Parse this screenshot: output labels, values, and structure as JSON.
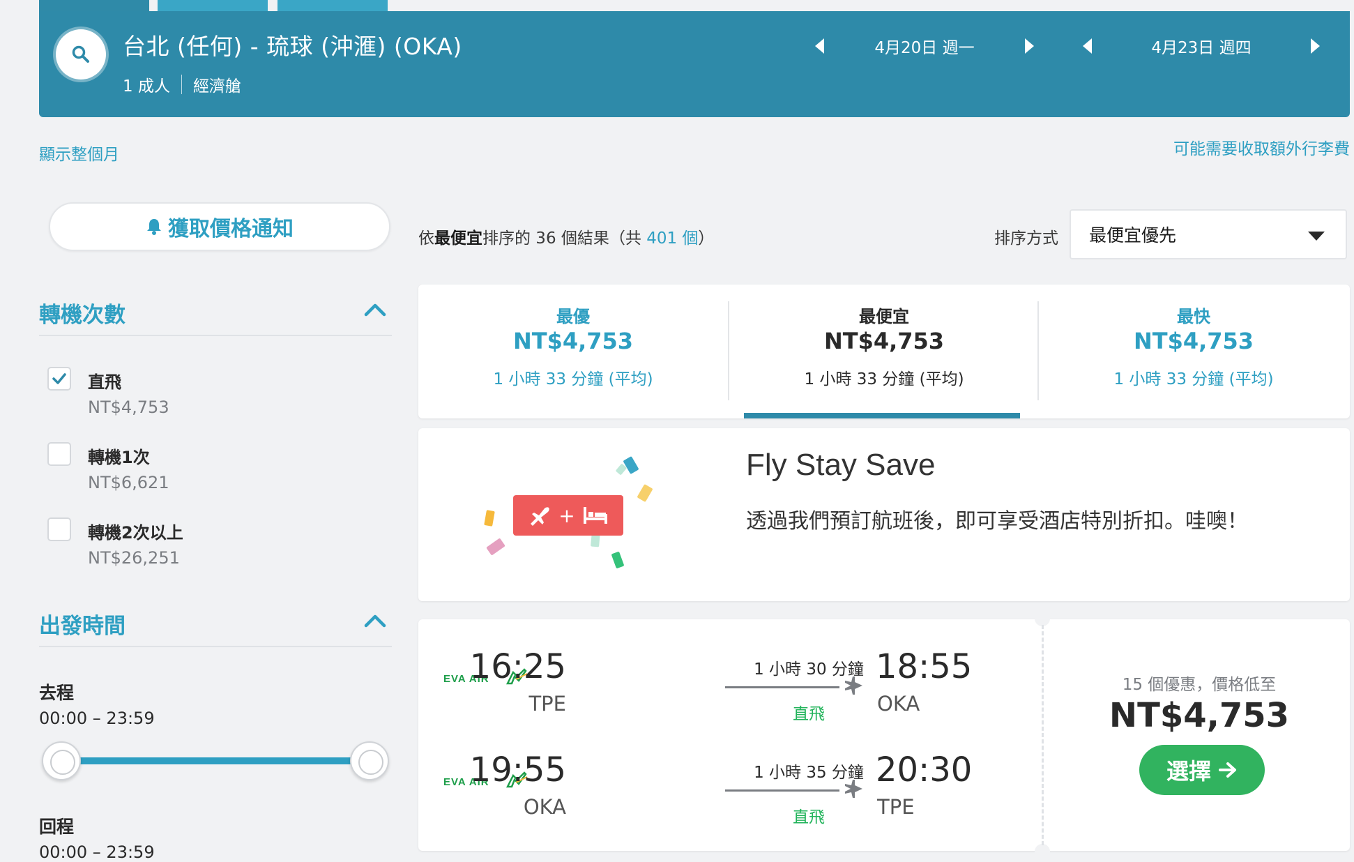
{
  "header": {
    "route": "台北 (任何) - 琉球 (沖滙) (OKA)",
    "passengers": "1 成人",
    "cabin": "經濟艙",
    "depart_date": "4月20日 週一",
    "return_date": "4月23日 週四"
  },
  "links": {
    "show_month": "顯示整個月",
    "baggage": "可能需要收取額外行李費"
  },
  "alert_button": "獲取價格通知",
  "filters": {
    "stops": {
      "title": "轉機次數",
      "options": [
        {
          "label": "直飛",
          "price": "NT$4,753",
          "checked": true
        },
        {
          "label": "轉機1次",
          "price": "NT$6,621",
          "checked": false
        },
        {
          "label": "轉機2次以上",
          "price": "NT$26,251",
          "checked": false
        }
      ]
    },
    "departure_time": {
      "title": "出發時間",
      "outbound_label": "去程",
      "outbound_range": "00:00 – 23:59",
      "return_label": "回程",
      "return_range": "00:00 – 23:59"
    }
  },
  "results": {
    "prefix": "依",
    "sort_bold": "最便宜",
    "middle": "排序的 36 個結果（共 ",
    "total": "401 個",
    "suffix": "）",
    "sort_label": "排序方式",
    "sort_value": "最便宜優先"
  },
  "sort_tabs": [
    {
      "label": "最優",
      "price": "NT$4,753",
      "duration": "1 小時 33 分鐘 (平均)"
    },
    {
      "label": "最便宜",
      "price": "NT$4,753",
      "duration": "1 小時 33 分鐘 (平均)"
    },
    {
      "label": "最快",
      "price": "NT$4,753",
      "duration": "1 小時 33 分鐘 (平均)"
    }
  ],
  "promo": {
    "title": "Fly Stay Save",
    "text": "透過我們預訂航班後，即可享受酒店特別折扣。哇噢！",
    "badge_plus": "+"
  },
  "flight": {
    "airline": "EVA AIR",
    "legs": [
      {
        "dep_time": "16:25",
        "dep_code": "TPE",
        "arr_time": "18:55",
        "arr_code": "OKA",
        "duration": "1 小時 30 分鐘",
        "stops": "直飛"
      },
      {
        "dep_time": "19:55",
        "dep_code": "OKA",
        "arr_time": "20:30",
        "arr_code": "TPE",
        "duration": "1 小時 35 分鐘",
        "stops": "直飛"
      }
    ],
    "deals": "15 個優惠，價格低至",
    "price": "NT$4,753",
    "select_label": "選擇"
  },
  "colors": {
    "header_bg": "#2e8aa9",
    "accent_blue": "#2e9fc2",
    "green": "#31b35f",
    "promo_red": "#ee5a5a",
    "eva_green": "#1e9e4a"
  }
}
